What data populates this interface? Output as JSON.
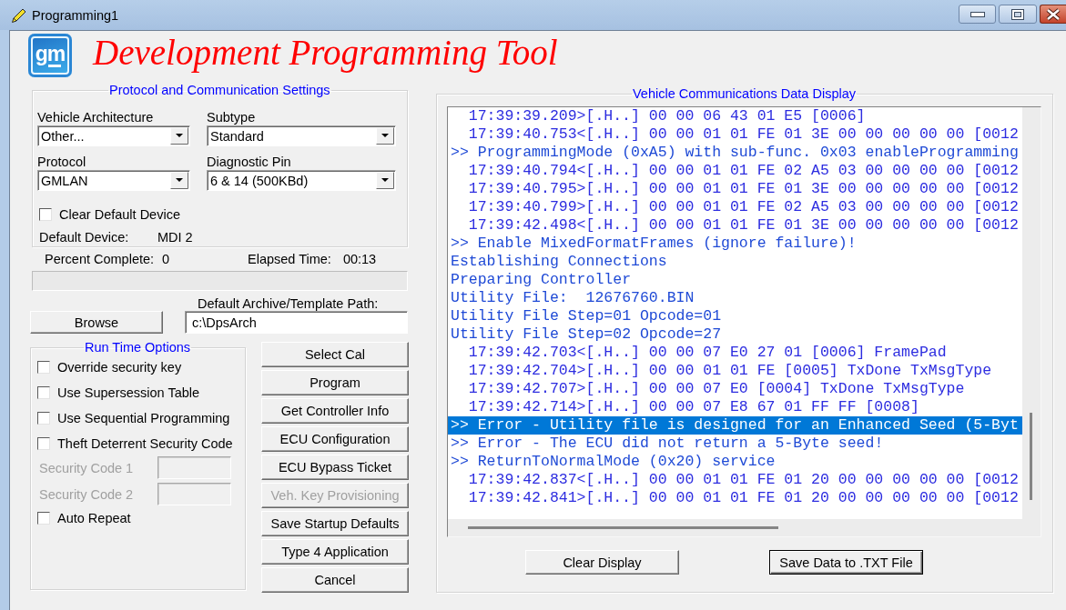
{
  "window": {
    "title": "Programming1"
  },
  "header": {
    "logo_text": "gm",
    "title": "Development Programming Tool"
  },
  "protocol_settings": {
    "title": "Protocol and Communication Settings",
    "dropdowns": [
      {
        "label": "Vehicle Architecture",
        "value": "Other..."
      },
      {
        "label": "Subtype",
        "value": "Standard"
      },
      {
        "label": "Protocol",
        "value": "GMLAN"
      },
      {
        "label": "Diagnostic Pin",
        "value": "6 & 14 (500KBd)"
      }
    ],
    "clear_default_device": {
      "label": "Clear Default Device",
      "checked": false
    },
    "default_device": {
      "label": "Default Device:",
      "value": "MDI 2"
    }
  },
  "progress": {
    "percent_label": "Percent Complete:",
    "percent_value": "0",
    "elapsed_label": "Elapsed Time:",
    "elapsed_value": "00:13",
    "level": 0
  },
  "archive": {
    "label": "Default Archive/Template Path:",
    "browse_button": "Browse",
    "path": "c:\\DpsArch"
  },
  "run_time_options": {
    "title": "Run Time Options",
    "items": [
      {
        "kind": "checkbox",
        "label": "Override security key",
        "checked": false,
        "disabled": false
      },
      {
        "kind": "checkbox",
        "label": "Use Supersession Table",
        "checked": false,
        "disabled": false
      },
      {
        "kind": "checkbox",
        "label": "Use Sequential Programming",
        "checked": false,
        "disabled": false
      },
      {
        "kind": "checkbox",
        "label": "Theft Deterrent Security Code",
        "checked": false,
        "disabled": false
      },
      {
        "kind": "field",
        "label": "Security Code 1",
        "disabled": true
      },
      {
        "kind": "field",
        "label": "Security Code 2",
        "disabled": true
      },
      {
        "kind": "checkbox",
        "label": "Auto Repeat",
        "checked": false,
        "disabled": false
      }
    ]
  },
  "actions": [
    {
      "label": "Select Cal",
      "disabled": false
    },
    {
      "label": "Program",
      "disabled": false
    },
    {
      "label": "Get Controller Info",
      "disabled": false
    },
    {
      "label": "ECU Configuration",
      "disabled": false
    },
    {
      "label": "ECU Bypass Ticket",
      "disabled": false
    },
    {
      "label": "Veh. Key Provisioning",
      "disabled": true
    },
    {
      "label": "Save Startup Defaults",
      "disabled": false
    },
    {
      "label": "Type 4 Application",
      "disabled": false
    },
    {
      "label": "Cancel",
      "disabled": false
    }
  ],
  "data_display": {
    "title": "Vehicle Communications Data Display",
    "lines": [
      {
        "kind": "frame",
        "text": "17:39:39.209>[.H..] 00 00 06 43 01 E5 [0006]",
        "selected": false
      },
      {
        "kind": "frame",
        "text": "17:39:40.753<[.H..] 00 00 01 01 FE 01 3E 00 00 00 00 00 [0012",
        "selected": false
      },
      {
        "kind": "message",
        "text": ">> ProgrammingMode (0xA5) with sub-func. 0x03 enableProgramming",
        "selected": false
      },
      {
        "kind": "frame",
        "text": "17:39:40.794<[.H..] 00 00 01 01 FE 02 A5 03 00 00 00 00 [0012",
        "selected": false
      },
      {
        "kind": "frame",
        "text": "17:39:40.795>[.H..] 00 00 01 01 FE 01 3E 00 00 00 00 00 [0012",
        "selected": false
      },
      {
        "kind": "frame",
        "text": "17:39:40.799>[.H..] 00 00 01 01 FE 02 A5 03 00 00 00 00 [0012",
        "selected": false
      },
      {
        "kind": "frame",
        "text": "17:39:42.498<[.H..] 00 00 01 01 FE 01 3E 00 00 00 00 00 [0012",
        "selected": false
      },
      {
        "kind": "message",
        "text": ">> Enable MixedFormatFrames (ignore failure)!",
        "selected": false
      },
      {
        "kind": "message",
        "text": "Establishing Connections",
        "selected": false
      },
      {
        "kind": "message",
        "text": "Preparing Controller",
        "selected": false
      },
      {
        "kind": "message",
        "text": "Utility File:  12676760.BIN",
        "selected": false
      },
      {
        "kind": "message",
        "text": "Utility File Step=01 Opcode=01",
        "selected": false
      },
      {
        "kind": "message",
        "text": "Utility File Step=02 Opcode=27",
        "selected": false
      },
      {
        "kind": "frame",
        "text": "17:39:42.703<[.H..] 00 00 07 E0 27 01 [0006] FramePad",
        "selected": false
      },
      {
        "kind": "frame",
        "text": "17:39:42.704>[.H..] 00 00 01 01 FE [0005] TxDone TxMsgType",
        "selected": false
      },
      {
        "kind": "frame",
        "text": "17:39:42.707>[.H..] 00 00 07 E0 [0004] TxDone TxMsgType",
        "selected": false
      },
      {
        "kind": "frame",
        "text": "17:39:42.714>[.H..] 00 00 07 E8 67 01 FF FF [0008]",
        "selected": false
      },
      {
        "kind": "message",
        "text": ">> Error - Utility file is designed for an Enhanced Seed (5-Byt",
        "selected": true
      },
      {
        "kind": "message",
        "text": ">> Error - The ECU did not return a 5-Byte seed!",
        "selected": false
      },
      {
        "kind": "message",
        "text": ">> ReturnToNormalMode (0x20) service",
        "selected": false
      },
      {
        "kind": "frame",
        "text": "17:39:42.837<[.H..] 00 00 01 01 FE 01 20 00 00 00 00 00 [0012",
        "selected": false
      },
      {
        "kind": "frame",
        "text": "17:39:42.841>[.H..] 00 00 01 01 FE 01 20 00 00 00 00 00 [0012",
        "selected": false
      }
    ],
    "buttons": [
      {
        "label": "Clear Display",
        "default": false
      },
      {
        "label": "Save Data to .TXT File",
        "default": true
      }
    ]
  }
}
